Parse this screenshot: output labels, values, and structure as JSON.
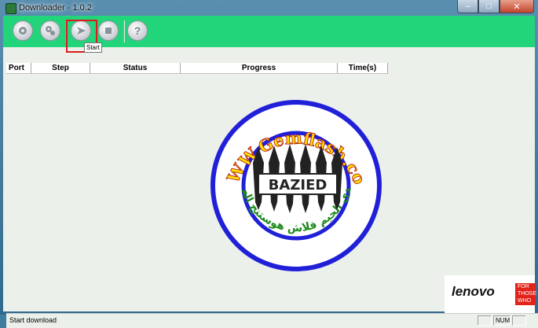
{
  "window": {
    "title": "Downloader - 1.0.2"
  },
  "toolbar": {
    "tooltip": "Start",
    "buttons": [
      {
        "name": "settings",
        "icon": "gear-icon"
      },
      {
        "name": "advanced-settings",
        "icon": "gears-icon"
      },
      {
        "name": "start",
        "icon": "play-arrow-icon"
      },
      {
        "name": "stop",
        "icon": "stop-square-icon"
      },
      {
        "name": "help",
        "icon": "question-icon"
      }
    ]
  },
  "table": {
    "columns": [
      "Port",
      "Step",
      "Status",
      "Progress",
      "Time(s)"
    ],
    "rows": []
  },
  "logo": {
    "url_text": "WWW.Gemflash.com",
    "center_text": "BAZIED",
    "arabic_text": "منتدى الجيم فلاش هوستنج العرب"
  },
  "brand": {
    "name": "lenovo",
    "tagline": [
      "FOR",
      "THOSE",
      "WHO DO."
    ]
  },
  "statusbar": {
    "message": "Start download",
    "num_indicator": "NUM"
  },
  "colors": {
    "toolbar": "#22d47a",
    "highlight": "#e0191c",
    "ring_blue": "#2020d8",
    "lenovo_red": "#e2231a"
  }
}
